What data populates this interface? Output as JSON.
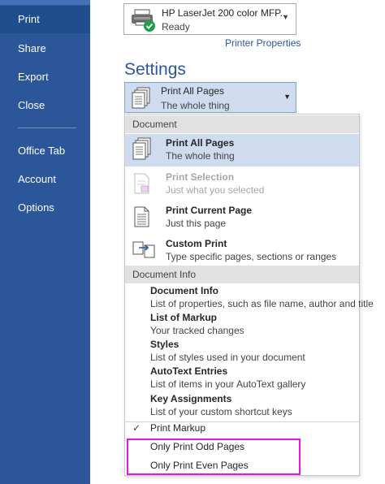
{
  "sidebar": {
    "items": [
      {
        "label": "Print",
        "selected": true
      },
      {
        "label": "Share"
      },
      {
        "label": "Export"
      },
      {
        "label": "Close"
      },
      {
        "label": "Office Tab"
      },
      {
        "label": "Account"
      },
      {
        "label": "Options"
      }
    ]
  },
  "printer": {
    "name": "HP LaserJet 200 color MFP...",
    "status": "Ready",
    "properties_link": "Printer Properties",
    "icon": "printer-icon"
  },
  "settings": {
    "heading": "Settings",
    "selected": {
      "title": "Print All Pages",
      "subtitle": "The whole thing"
    }
  },
  "menu": {
    "document_header": "Document",
    "document_options": [
      {
        "title": "Print All Pages",
        "subtitle": "The whole thing",
        "state": "highlighted"
      },
      {
        "title": "Print Selection",
        "subtitle": "Just what you selected",
        "state": "disabled"
      },
      {
        "title": "Print Current Page",
        "subtitle": "Just this page",
        "state": "normal"
      },
      {
        "title": "Custom Print",
        "subtitle": "Type specific pages, sections or ranges",
        "state": "normal"
      }
    ],
    "info_header": "Document Info",
    "info_options": [
      {
        "title": "Document Info",
        "subtitle": "List of properties, such as file name, author and title"
      },
      {
        "title": "List of Markup",
        "subtitle": "Your tracked changes"
      },
      {
        "title": "Styles",
        "subtitle": "List of styles used in your document"
      },
      {
        "title": "AutoText Entries",
        "subtitle": "List of items in your AutoText gallery"
      },
      {
        "title": "Key Assignments",
        "subtitle": "List of your custom shortcut keys"
      }
    ],
    "toggles": [
      {
        "label": "Print Markup",
        "checked": true,
        "check_glyph": "✓"
      },
      {
        "label": "Only Print Odd Pages",
        "checked": false
      },
      {
        "label": "Only Print Even Pages",
        "checked": false
      }
    ]
  },
  "colors": {
    "sidebar_bg": "#2b579a",
    "accent": "#2b579a",
    "highlight": "#cfdcef",
    "annotation_box": "#e614e6"
  }
}
